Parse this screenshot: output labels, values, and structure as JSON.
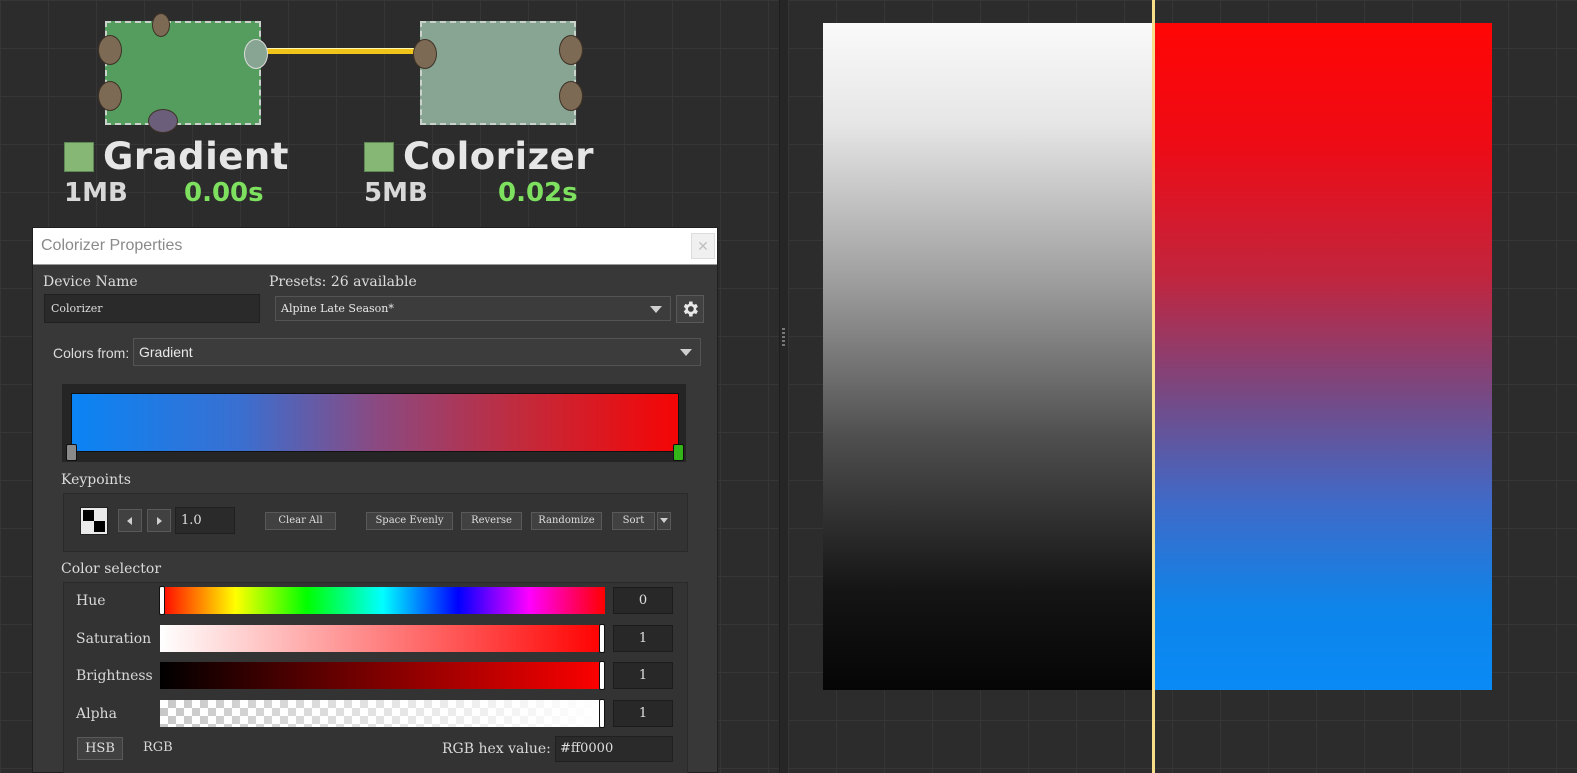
{
  "graph": {
    "nodes": [
      {
        "title": "Gradient",
        "memory": "1MB",
        "time": "0.00s"
      },
      {
        "title": "Colorizer",
        "memory": "5MB",
        "time": "0.02s"
      }
    ]
  },
  "panel": {
    "title": "Colorizer Properties",
    "close_glyph": "✕",
    "device_name_label": "Device Name",
    "device_name_value": "Colorizer",
    "presets_label": "Presets: 26 available",
    "preset_selected": "Alpine Late Season*",
    "colors_from_label": "Colors from:",
    "colors_from_value": "Gradient",
    "gradient": {
      "start_color": "#0a84f5",
      "end_color": "#f50505"
    },
    "keypoints": {
      "label": "Keypoints",
      "position_value": "1.0",
      "buttons": [
        "Clear All",
        "Space Evenly",
        "Reverse",
        "Randomize",
        "Sort"
      ]
    },
    "color_selector": {
      "label": "Color selector",
      "sliders": [
        {
          "label": "Hue",
          "value": "0"
        },
        {
          "label": "Saturation",
          "value": "1"
        },
        {
          "label": "Brightness",
          "value": "1"
        },
        {
          "label": "Alpha",
          "value": "1"
        }
      ],
      "mode_hsb": "HSB",
      "mode_rgb": "RGB",
      "hex_label": "RGB hex value:",
      "hex_value": "#ff0000"
    }
  },
  "colors": {
    "node_green": "#559c5f",
    "node_gray_green": "#87a592",
    "wire": "#f0c419",
    "time_green": "#7de05e",
    "selected_keypoint": "#33b51a"
  }
}
